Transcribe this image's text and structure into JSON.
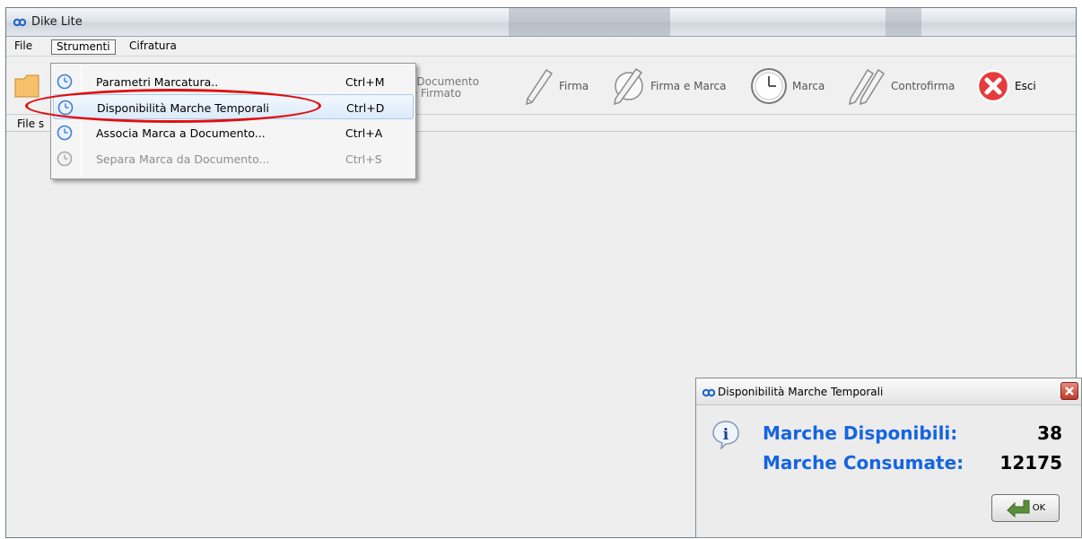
{
  "window": {
    "title": "Dike Lite"
  },
  "menubar": {
    "items": [
      "File",
      "Strumenti",
      "Cifratura"
    ]
  },
  "toolbar": {
    "estrai_line1": "rai Documento",
    "estrai_line2": "File Firmato",
    "firma": "Firma",
    "firma_marca": "Firma e Marca",
    "marca": "Marca",
    "controfirma": "Controfirma",
    "esci": "Esci"
  },
  "status": {
    "file_label": "File s"
  },
  "dropdown": {
    "items": [
      {
        "label": "Parametri Marcatura..",
        "shortcut": "Ctrl+M",
        "state": "normal"
      },
      {
        "label": "Disponibilità Marche Temporali",
        "shortcut": "Ctrl+D",
        "state": "selected"
      },
      {
        "label": "Associa Marca a Documento...",
        "shortcut": "Ctrl+A",
        "state": "normal"
      },
      {
        "label": "Separa Marca da Documento...",
        "shortcut": "Ctrl+S",
        "state": "disabled"
      }
    ]
  },
  "dialog": {
    "title": "Disponibilità Marche Temporali",
    "available_label": "Marche Disponibili:",
    "available_value": "38",
    "consumed_label": "Marche Consumate:",
    "consumed_value": "12175",
    "ok_label": "OK"
  },
  "colors": {
    "label_blue": "#1565e0",
    "annotation_red": "#e01010",
    "close_red": "#c0392b"
  }
}
